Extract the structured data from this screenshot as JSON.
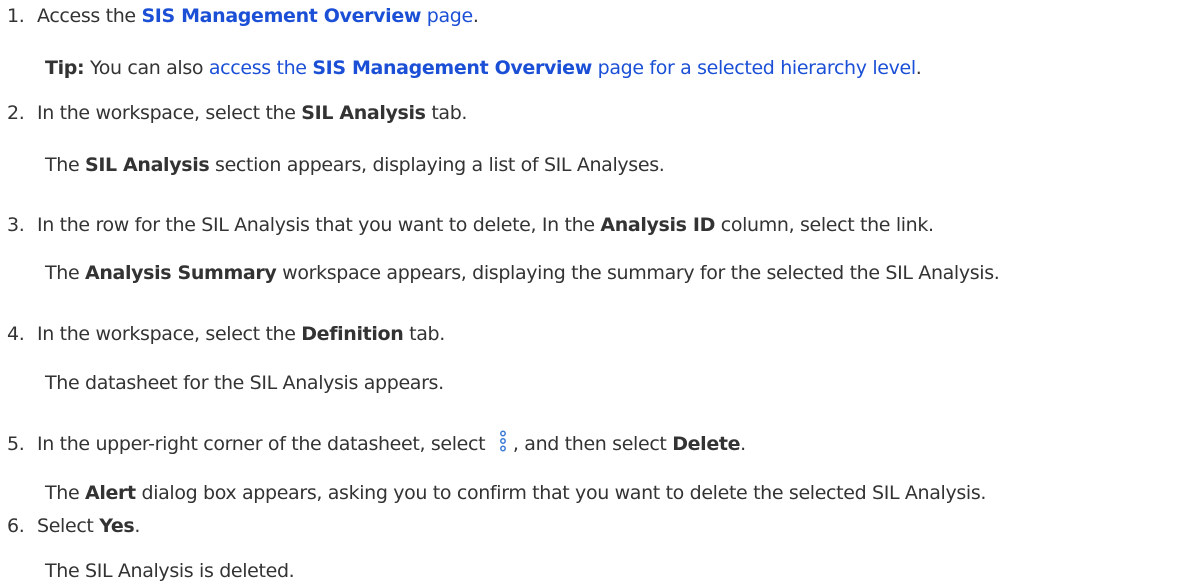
{
  "steps": [
    {
      "number": "1.",
      "pre": "Access the ",
      "link_bold": "SIS Management Overview",
      "link_after": " page",
      "post": ".",
      "tip_label": "Tip:",
      "tip_pre": " You can also ",
      "tip_link_pre": "access the ",
      "tip_link_bold": "SIS Management Overview",
      "tip_link_post": " page for a selected hierarchy level",
      "tip_post": "."
    },
    {
      "number": "2.",
      "pre": "In the workspace, select the ",
      "bold": "SIL Analysis",
      "post": " tab.",
      "result_bold": "SIL Analysis",
      "result_post": " section appears, displaying a list of SIL Analyses.",
      "result_pre": "The "
    },
    {
      "number": "3.",
      "pre": "In the row for the SIL Analysis that you want to delete, In the ",
      "bold": "Analysis ID",
      "post": " column, select the link.",
      "result_pre": "The ",
      "result_bold": "Analysis Summary",
      "result_post": " workspace appears, displaying the summary for the selected the SIL Analysis."
    },
    {
      "number": "4.",
      "pre": "In the workspace, select the ",
      "bold": "Definition",
      "post": " tab.",
      "result": "The datasheet for the SIL Analysis appears."
    },
    {
      "number": "5.",
      "pre": "In the upper-right corner of the datasheet, select ",
      "mid": ", and then select ",
      "bold": "Delete",
      "post": ".",
      "icon": "more-options-icon",
      "result_pre": "The ",
      "result_bold": "Alert",
      "result_post": " dialog box appears, asking you to confirm that you want to delete the selected SIL Analysis."
    },
    {
      "number": "6.",
      "pre": "Select ",
      "bold": "Yes",
      "post": ".",
      "result": "The SIL Analysis is deleted."
    }
  ],
  "colors": {
    "text": "#333333",
    "link": "#1a4fd6",
    "icon": "#3b7bd6"
  }
}
